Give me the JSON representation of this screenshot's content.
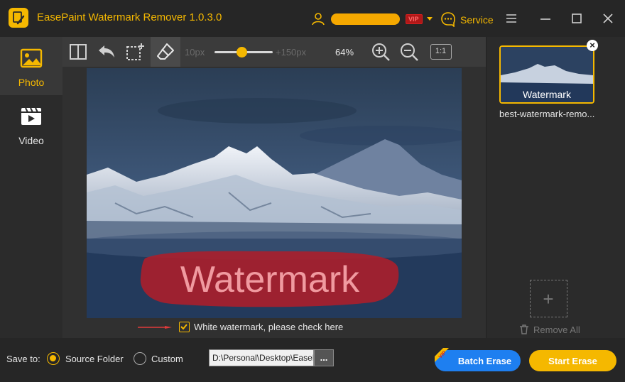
{
  "app": {
    "title": "EasePaint Watermark Remover  1.0.3.0",
    "service_label": "Service",
    "vip_label": "VIP"
  },
  "sidebar": {
    "items": [
      {
        "label": "Photo",
        "icon": "photo-icon",
        "active": true
      },
      {
        "label": "Video",
        "icon": "video-icon",
        "active": false
      }
    ]
  },
  "toolbar": {
    "brush_min": "10px",
    "brush_max": "+150px",
    "brush_level": 0.47,
    "zoom": "64%",
    "actual_size_label": "1:1"
  },
  "canvas": {
    "watermark_text": "Watermark",
    "white_watermark_label": "White watermark, please check here",
    "white_watermark_checked": true
  },
  "file_list": {
    "items": [
      {
        "name": "best-watermark-remo...",
        "thumb_text": "Watermark"
      }
    ],
    "remove_all_label": "Remove All"
  },
  "bottom": {
    "save_to_label": "Save to:",
    "source_folder_label": "Source Folder",
    "custom_label": "Custom",
    "selected_option": "Source Folder",
    "path_value": "D:\\Personal\\Desktop\\EasePaint",
    "browse_label": "...",
    "batch_erase_label": "Batch Erase",
    "batch_vip_label": "VIP",
    "start_erase_label": "Start Erase"
  },
  "colors": {
    "accent": "#f5b800",
    "batch_blue": "#1e7ff0",
    "background": "#2b2b2b",
    "vip_red": "#d81e1e"
  }
}
